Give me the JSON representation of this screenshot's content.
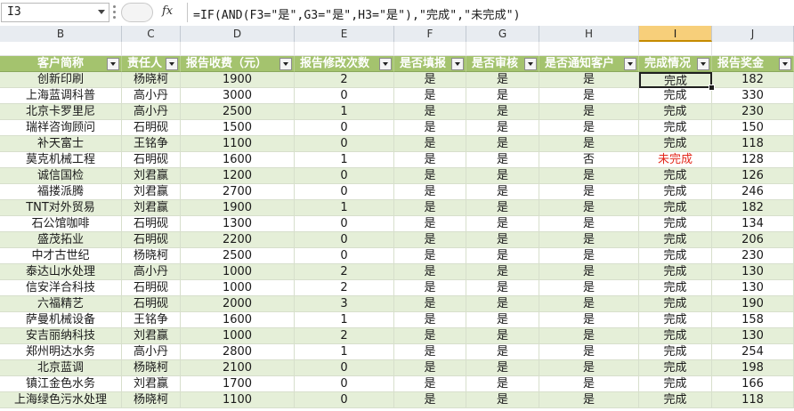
{
  "name_box": "I3",
  "formula": "=IF(AND(F3=\"是\",G3=\"是\",H3=\"是\"),\"完成\",\"未完成\")",
  "fx_label": "fx",
  "columns": [
    "B",
    "C",
    "D",
    "E",
    "F",
    "G",
    "H",
    "I",
    "J"
  ],
  "active_column": "I",
  "headers": [
    "客户简称",
    "责任人",
    "报告收费（元）",
    "报告修改次数",
    "是否填报",
    "是否审核",
    "是否通知客户",
    "完成情况",
    "报告奖金"
  ],
  "rows": [
    [
      "创新印刷",
      "杨晓柯",
      "1900",
      "2",
      "是",
      "是",
      "是",
      "完成",
      "182"
    ],
    [
      "上海蓝调科普",
      "高小丹",
      "3000",
      "0",
      "是",
      "是",
      "是",
      "完成",
      "330"
    ],
    [
      "北京卡罗里尼",
      "高小丹",
      "2500",
      "1",
      "是",
      "是",
      "是",
      "完成",
      "230"
    ],
    [
      "瑞祥咨询顾问",
      "石明砚",
      "1500",
      "0",
      "是",
      "是",
      "是",
      "完成",
      "150"
    ],
    [
      "补天富士",
      "王铭争",
      "1100",
      "0",
      "是",
      "是",
      "是",
      "完成",
      "118"
    ],
    [
      "莫克机械工程",
      "石明砚",
      "1600",
      "1",
      "是",
      "是",
      "否",
      "未完成",
      "128"
    ],
    [
      "诚信国检",
      "刘君赢",
      "1200",
      "0",
      "是",
      "是",
      "是",
      "完成",
      "126"
    ],
    [
      "福搂派腾",
      "刘君赢",
      "2700",
      "0",
      "是",
      "是",
      "是",
      "完成",
      "246"
    ],
    [
      "TNT对外贸易",
      "刘君赢",
      "1900",
      "1",
      "是",
      "是",
      "是",
      "完成",
      "182"
    ],
    [
      "石公馆咖啡",
      "石明砚",
      "1300",
      "0",
      "是",
      "是",
      "是",
      "完成",
      "134"
    ],
    [
      "盛茂拓业",
      "石明砚",
      "2200",
      "0",
      "是",
      "是",
      "是",
      "完成",
      "206"
    ],
    [
      "中才古世纪",
      "杨晓柯",
      "2500",
      "0",
      "是",
      "是",
      "是",
      "完成",
      "230"
    ],
    [
      "泰达山水处理",
      "高小丹",
      "1000",
      "2",
      "是",
      "是",
      "是",
      "完成",
      "130"
    ],
    [
      "信安洋合科技",
      "石明砚",
      "1000",
      "2",
      "是",
      "是",
      "是",
      "完成",
      "130"
    ],
    [
      "六福精艺",
      "石明砚",
      "2000",
      "3",
      "是",
      "是",
      "是",
      "完成",
      "190"
    ],
    [
      "萨曼机械设备",
      "王铭争",
      "1600",
      "1",
      "是",
      "是",
      "是",
      "完成",
      "158"
    ],
    [
      "安吉丽纳科技",
      "刘君赢",
      "1000",
      "2",
      "是",
      "是",
      "是",
      "完成",
      "130"
    ],
    [
      "郑州明达水务",
      "高小丹",
      "2800",
      "1",
      "是",
      "是",
      "是",
      "完成",
      "254"
    ],
    [
      "北京蓝调",
      "杨晓柯",
      "2100",
      "0",
      "是",
      "是",
      "是",
      "完成",
      "198"
    ],
    [
      "镇江金色水务",
      "刘君赢",
      "1700",
      "0",
      "是",
      "是",
      "是",
      "完成",
      "166"
    ],
    [
      "上海绿色污水处理",
      "杨晓柯",
      "1100",
      "0",
      "是",
      "是",
      "是",
      "完成",
      "118"
    ]
  ],
  "colors": {
    "header_bg": "#a4c36e",
    "band_bg": "#e5efd8",
    "incomplete_text": "#e3281b",
    "active_col_header": "#f7cf7a"
  }
}
